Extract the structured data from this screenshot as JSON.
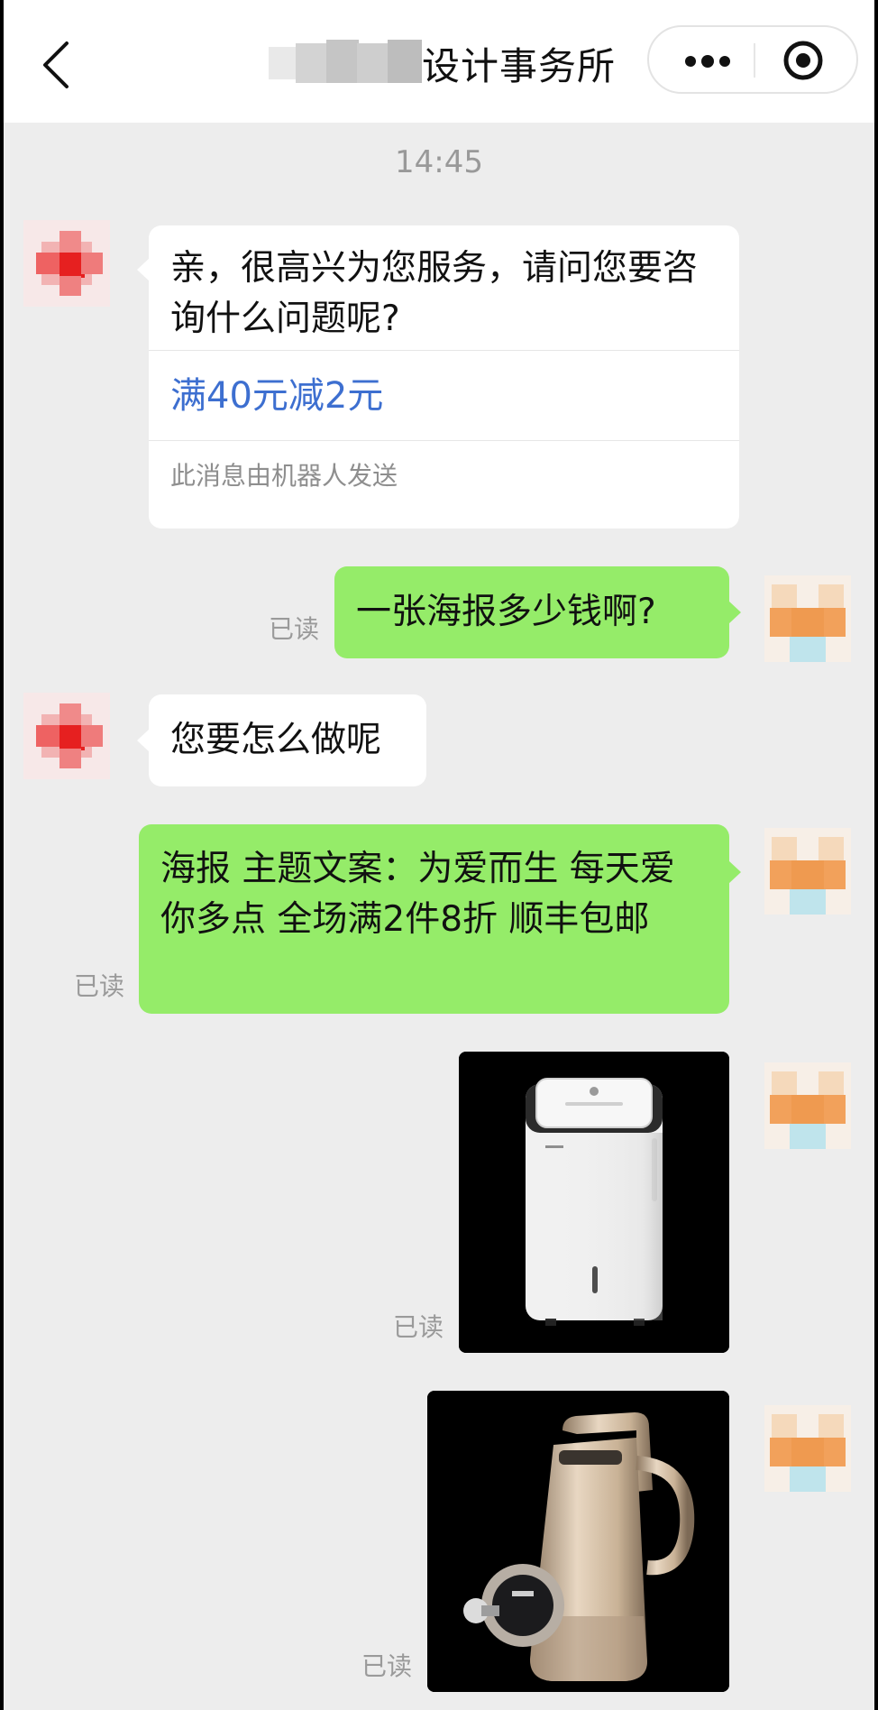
{
  "header": {
    "title": "设计事务所",
    "back_icon": "chevron-left-icon",
    "more_icon": "more-dots-icon",
    "close_icon": "target-circle-icon"
  },
  "chat": {
    "timestamp": "14:45",
    "messages": [
      {
        "side": "left",
        "text": "亲，很高兴为您服务，请问您要咨询什么问题呢?",
        "link": "满40元减2元",
        "note": "此消息由机器人发送"
      },
      {
        "side": "right",
        "text": "一张海报多少钱啊?",
        "status": "已读"
      },
      {
        "side": "left",
        "text": "您要怎么做呢"
      },
      {
        "side": "right",
        "text": "海报 主题文案：为爱而生 每天爱你多点 全场满2件8折 顺丰包邮",
        "status": "已读"
      },
      {
        "side": "right",
        "type": "image",
        "image": "dehumidifier-photo",
        "status": "已读"
      },
      {
        "side": "right",
        "type": "image",
        "image": "soymilk-maker-photo",
        "status": "已读"
      }
    ]
  },
  "colors": {
    "background": "#ededed",
    "header": "#ffffff",
    "self_bubble": "#95ec69",
    "other_bubble": "#ffffff",
    "link": "#3d6fd0",
    "status": "#9a9a9a"
  }
}
